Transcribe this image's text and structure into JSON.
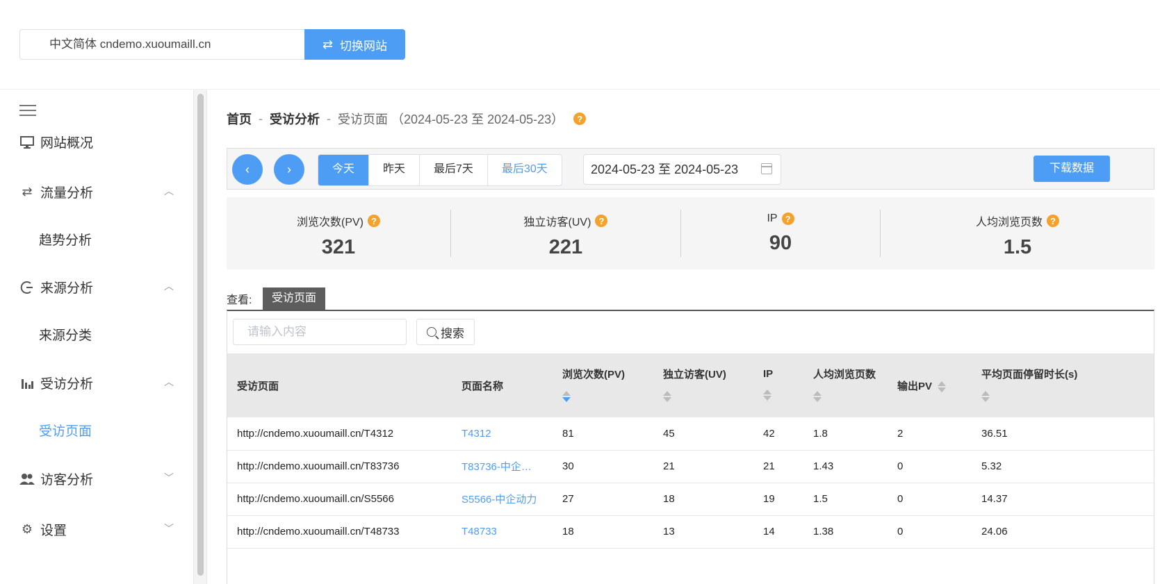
{
  "topbar": {
    "site_value": "中文简体 cndemo.xuoumaill.cn",
    "switch_label": "切换网站"
  },
  "sidebar": {
    "items": [
      {
        "label": "网站概况",
        "icon": "monitor-icon"
      },
      {
        "label": "流量分析",
        "icon": "swap-icon",
        "expanded": true
      },
      {
        "label": "趋势分析",
        "sub": true
      },
      {
        "label": "来源分析",
        "icon": "source-icon",
        "expanded": true
      },
      {
        "label": "来源分类",
        "sub": true
      },
      {
        "label": "受访分析",
        "icon": "bar-chart-icon",
        "expanded": true
      },
      {
        "label": "受访页面",
        "sub": true,
        "active": true
      },
      {
        "label": "访客分析",
        "icon": "users-icon",
        "expanded": false
      },
      {
        "label": "设置",
        "icon": "gear-icon",
        "expanded": false
      }
    ]
  },
  "breadcrumb": {
    "home": "首页",
    "section": "受访分析",
    "current": "受访页面 （2024-05-23 至 2024-05-23）",
    "sep": "-"
  },
  "toolbar": {
    "prev": "‹",
    "next": "›",
    "ranges": [
      "今天",
      "昨天",
      "最后7天",
      "最后30天"
    ],
    "date_range": "2024-05-23 至 2024-05-23",
    "download_label": "下载数据"
  },
  "stats": [
    {
      "label": "浏览次数(PV)",
      "value": "321"
    },
    {
      "label": "独立访客(UV)",
      "value": "221"
    },
    {
      "label": "IP",
      "value": "90"
    },
    {
      "label": "人均浏览页数",
      "value": "1.5"
    }
  ],
  "view": {
    "label": "查看:",
    "tab": "受访页面"
  },
  "search": {
    "placeholder": "请输入内容",
    "button": "搜索"
  },
  "table": {
    "headers": [
      "受访页面",
      "页面名称",
      "浏览次数(PV)",
      "独立访客(UV)",
      "IP",
      "人均浏览页数",
      "输出PV",
      "平均页面停留时长(s)"
    ],
    "rows": [
      [
        "http://cndemo.xuoumaill.cn/T4312",
        "T4312",
        "81",
        "45",
        "42",
        "1.8",
        "2",
        "36.51"
      ],
      [
        "http://cndemo.xuoumaill.cn/T83736",
        "T83736-中企…",
        "30",
        "21",
        "21",
        "1.43",
        "0",
        "5.32"
      ],
      [
        "http://cndemo.xuoumaill.cn/S5566",
        "S5566-中企动力",
        "27",
        "18",
        "19",
        "1.5",
        "0",
        "14.37"
      ],
      [
        "http://cndemo.xuoumaill.cn/T48733",
        "T48733",
        "18",
        "13",
        "14",
        "1.38",
        "0",
        "24.06"
      ]
    ]
  },
  "help_glyph": "?",
  "colors": {
    "accent": "#4e9df5",
    "help": "#f4a22d"
  }
}
